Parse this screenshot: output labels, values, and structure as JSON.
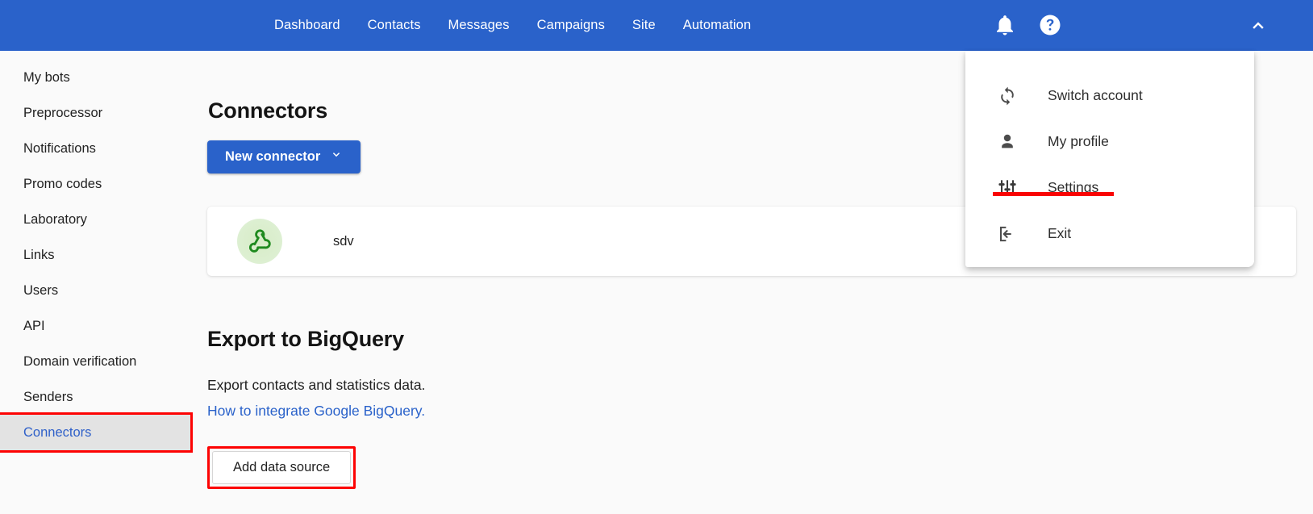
{
  "topnav": {
    "background": "#2a62ca",
    "links": [
      {
        "label": "Dashboard"
      },
      {
        "label": "Contacts"
      },
      {
        "label": "Messages"
      },
      {
        "label": "Campaigns"
      },
      {
        "label": "Site"
      },
      {
        "label": "Automation"
      }
    ],
    "icons": {
      "notifications": "bell-icon",
      "help": "help-circle-icon",
      "account_toggle": "chevron-up-icon"
    }
  },
  "sidebar": {
    "items": [
      {
        "label": "My bots",
        "active": false
      },
      {
        "label": "Preprocessor",
        "active": false
      },
      {
        "label": "Notifications",
        "active": false
      },
      {
        "label": "Promo codes",
        "active": false
      },
      {
        "label": "Laboratory",
        "active": false
      },
      {
        "label": "Links",
        "active": false
      },
      {
        "label": "Users",
        "active": false
      },
      {
        "label": "API",
        "active": false
      },
      {
        "label": "Domain verification",
        "active": false
      },
      {
        "label": "Senders",
        "active": false
      },
      {
        "label": "Connectors",
        "active": true
      }
    ],
    "active_item": "Connectors",
    "highlight_color": "#fd0303",
    "active_text_color": "#3061c9",
    "active_background": "#e3e3e3"
  },
  "main": {
    "connectors": {
      "title": "Connectors",
      "new_connector_label": "New connector",
      "new_connector_caret": "chevron-down-icon",
      "list": [
        {
          "name": "sdv",
          "icon": "webhook-icon",
          "icon_color": "#1f8a1f"
        }
      ]
    },
    "bigquery": {
      "title": "Export to BigQuery",
      "description": "Export contacts and statistics data.",
      "link_text": "How to integrate Google BigQuery.",
      "link_color": "#2a62ca",
      "add_button_label": "Add data source",
      "add_button_highlight_color": "#fd0303"
    }
  },
  "user_menu": {
    "items": [
      {
        "label": "Switch account",
        "icon": "sync-icon"
      },
      {
        "label": "My profile",
        "icon": "person-icon"
      },
      {
        "label": "Settings",
        "icon": "tune-sliders-icon"
      },
      {
        "label": "Exit",
        "icon": "logout-icon"
      }
    ],
    "highlighted_item": "Settings",
    "highlight_color": "#f90404"
  }
}
